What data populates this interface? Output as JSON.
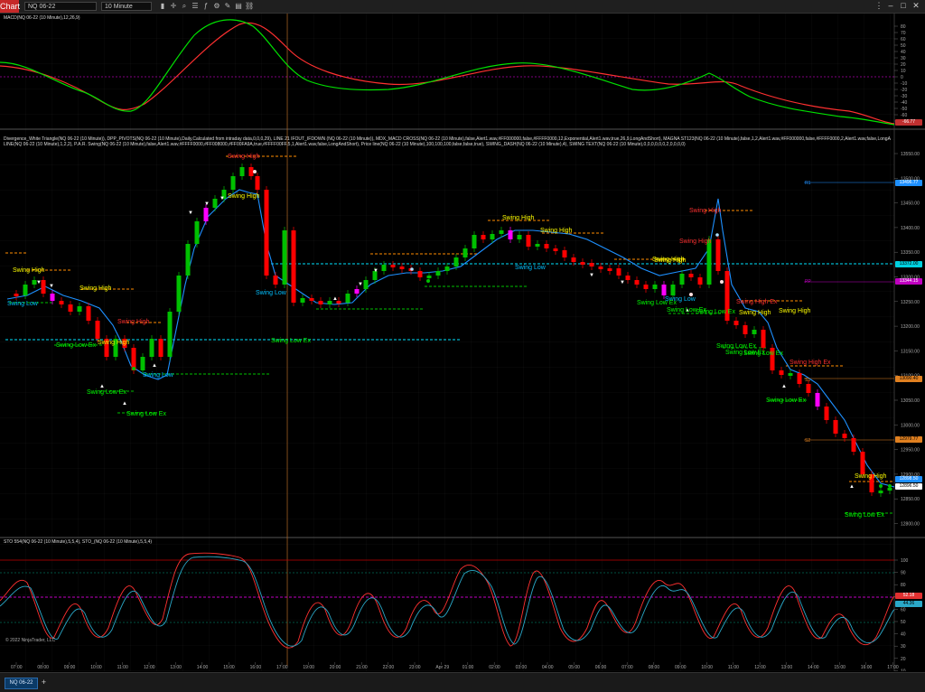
{
  "toolbar": {
    "chart_tab": "Chart",
    "instrument": "NQ 06-22",
    "timeframe": "10 Minute"
  },
  "panels": {
    "macd_label": "MACD(NQ 06-22 (10 Minute),12,26,9)",
    "main_label_1": "Divergence_White Triangle(NQ 06-22 (10 Minute)), DPP_PIVOTS(NQ 06-22 (10 Minute),Daily,Calculated from intraday data,0,0,0,29), LINE 21 IFOUT_IFDOWN (NQ 06-22 (10 Minute)), MDX_MACD CROSS(NQ 06-22 (10 Minute),false,Alert1.wav,#FF000000,false,#FFFF0000,12,Exponential,Alert1.wav,true,26,9,LongAndShort), MAGNA ST123(NQ 06-22 (10 Minute),false,1,2,Alert1.wav,#FF000000,false,#FFFF0000,2,Alert1.wav,false,LongAndShort), MAGNA TRIGGER REF",
    "main_label_2": "LINE(NQ 06-22 (10 Minute),1,2,2), P.A.R. Swing(NQ 06-22 (10 Minute),false,Alert1.wav,#FFFF0000,#FF008000,#FF00FA9A,true,#FFFF00FF,5,1,Alert1.wav,false,LongAndShort), Price line(NQ 06-22 (10 Minute),100,100,100,false,false,true), SWING_DASH(NQ 06-22 (10 Minute),4), SWING TEXT(NQ 06-22 (10 Minute),0,0,0,0,0,0,2,0,0,0,0)",
    "sto_label": "STO 554(NQ 06-22 (10 Minute),5,5,4), STO_(NQ 06-22 (10 Minute),5,5,4)"
  },
  "macd_axis": [
    "80",
    "70",
    "60",
    "50",
    "40",
    "30",
    "20",
    "10",
    "0",
    "-10",
    "-20",
    "-30",
    "-40",
    "-50",
    "-60",
    "-70"
  ],
  "price_axis": [
    "13550.00",
    "13500.00",
    "13450.00",
    "13400.00",
    "13350.00",
    "13300.00",
    "13250.00",
    "13200.00",
    "13150.00",
    "13100.00",
    "13050.00",
    "13000.00",
    "12950.00",
    "12900.00",
    "12850.00",
    "12800.00"
  ],
  "sto_axis": [
    "100",
    "90",
    "80",
    "70",
    "60",
    "50",
    "40",
    "30",
    "20",
    "10"
  ],
  "time_axis": [
    "07:00",
    "08:00",
    "09:00",
    "10:00",
    "11:00",
    "12:00",
    "13:00",
    "14:00",
    "15:00",
    "16:00",
    "17:00",
    "19:00",
    "20:00",
    "21:00",
    "22:00",
    "23:00",
    "Apr 29",
    "01:00",
    "02:00",
    "03:00",
    "04:00",
    "05:00",
    "06:00",
    "07:00",
    "08:00",
    "09:00",
    "10:00",
    "11:00",
    "12:00",
    "13:00",
    "14:00",
    "15:00",
    "16:00",
    "17:00"
  ],
  "badges": {
    "macd_value": "-66.77",
    "r1_value": "13496.77",
    "pp_value": "13372.00",
    "pp2_value": "13344.15",
    "s1_value": "13090.40",
    "s2_value": "12979.77",
    "price_ask": "12898.50",
    "price_last": "12896.50",
    "sto_k": "52.18",
    "sto_d": "44.36"
  },
  "pivot_tags": {
    "r1": "R1",
    "pp": "PP",
    "s1": "S1",
    "s2": "S2"
  },
  "swing_labels": [
    {
      "text": "Swing High",
      "color": "#ff3030"
    },
    {
      "text": "Swing High",
      "color": "#ffff00"
    },
    {
      "text": "Swing High",
      "color": "#ffff00"
    },
    {
      "text": "Swing High",
      "color": "#ffff00"
    },
    {
      "text": "Swing High",
      "color": "#ff3030"
    },
    {
      "text": "Swing High",
      "color": "#ffff00"
    },
    {
      "text": "Swing High",
      "color": "#ffff00"
    },
    {
      "text": "Swing High",
      "color": "#ffff00"
    },
    {
      "text": "Swing High",
      "color": "#ff3030"
    },
    {
      "text": "Swing High",
      "color": "#ff3030"
    },
    {
      "text": "Swing High Ex",
      "color": "#ff3030"
    },
    {
      "text": "Swing High",
      "color": "#ffff00"
    },
    {
      "text": "Swing High Ex",
      "color": "#ff3030"
    },
    {
      "text": "Swing High",
      "color": "#ffff00"
    },
    {
      "text": "Swing High",
      "color": "#ffff00"
    },
    {
      "text": "Swing High",
      "color": "#ffff00"
    },
    {
      "text": "Swing High",
      "color": "#ffff00"
    },
    {
      "text": "Swing Low",
      "color": "#00bfff"
    },
    {
      "text": "Swing Low",
      "color": "#00bfff"
    },
    {
      "text": "Swing Low",
      "color": "#00bfff"
    },
    {
      "text": "Swing Low",
      "color": "#00bfff"
    },
    {
      "text": "Swing Low",
      "color": "#00bfff"
    },
    {
      "text": "Swing Low Ex",
      "color": "#00ff00"
    },
    {
      "text": "Swing Low Ex",
      "color": "#00ff00"
    },
    {
      "text": "Swing Low Ex",
      "color": "#00ff00"
    },
    {
      "text": "Swing Low Ex",
      "color": "#00ff00"
    },
    {
      "text": "Swing Low Ex",
      "color": "#00ff00"
    },
    {
      "text": "Swing Low Ex",
      "color": "#00ff00"
    },
    {
      "text": "Swing Low Ex",
      "color": "#00ff00"
    },
    {
      "text": "Swing Low Ex",
      "color": "#00ff00"
    },
    {
      "text": "Swing Low Ex",
      "color": "#00ff00"
    },
    {
      "text": "Swing Low Ex",
      "color": "#00ff00"
    },
    {
      "text": "Swing Low Ex",
      "color": "#00ff00"
    },
    {
      "text": "Swing Low Ex",
      "color": "#00ff00"
    }
  ],
  "copyright": "© 2022 NinjaTrader, LLC",
  "bottom": {
    "tab": "NQ 06-22",
    "add": "+"
  },
  "colors": {
    "bull": "#00c000",
    "bear": "#ff0000",
    "trail": "#1e90ff",
    "pivot": "#00e5ff",
    "sto_k": "#ff3030",
    "sto_d": "#2aa8c8",
    "magenta": "#c000c0"
  }
}
